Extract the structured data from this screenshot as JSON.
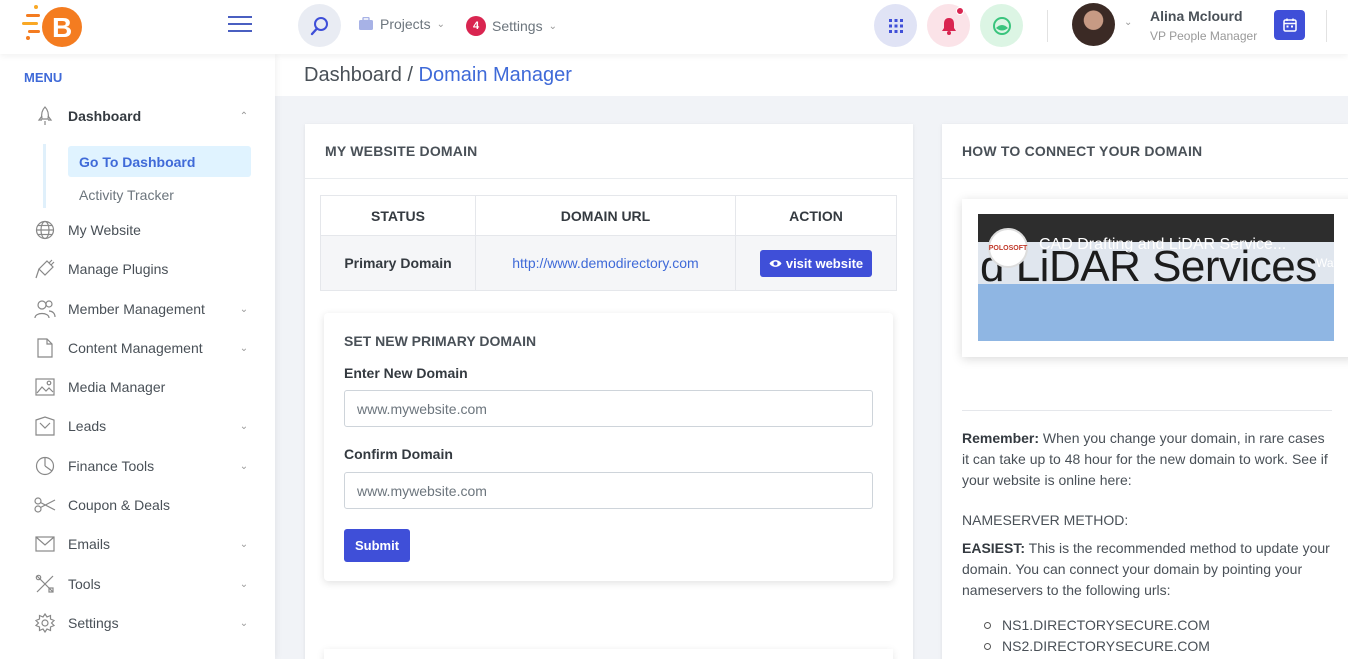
{
  "header": {
    "projects_label": "Projects",
    "settings_label": "Settings",
    "settings_badge": "4",
    "user_name": "Alina Mclourd",
    "user_role": "VP People Manager"
  },
  "sidebar": {
    "menu_title": "MENU",
    "items": [
      {
        "label": "Dashboard"
      },
      {
        "label": "My Website"
      },
      {
        "label": "Manage Plugins"
      },
      {
        "label": "Member Management"
      },
      {
        "label": "Content Management"
      },
      {
        "label": "Media Manager"
      },
      {
        "label": "Leads"
      },
      {
        "label": "Finance Tools"
      },
      {
        "label": "Coupon & Deals"
      },
      {
        "label": "Emails"
      },
      {
        "label": "Tools"
      },
      {
        "label": "Settings"
      }
    ],
    "sub_items": [
      {
        "label": "Go To Dashboard"
      },
      {
        "label": "Activity Tracker"
      }
    ]
  },
  "breadcrumb": {
    "root": "Dashboard",
    "separator": "/",
    "current": "Domain Manager"
  },
  "domain_card": {
    "title": "MY WEBSITE DOMAIN",
    "columns": [
      "STATUS",
      "DOMAIN URL",
      "ACTION"
    ],
    "row": {
      "status": "Primary Domain",
      "url": "http://www.demodirectory.com",
      "action": "visit website"
    }
  },
  "set_domain": {
    "title": "SET NEW PRIMARY DOMAIN",
    "new_label": "Enter New Domain",
    "new_placeholder": "www.mywebsite.com",
    "confirm_label": "Confirm Domain",
    "confirm_placeholder": "www.mywebsite.com",
    "submit_label": "Submit"
  },
  "connect_card": {
    "title": "HOW TO CONNECT YOUR DOMAIN",
    "video": {
      "title": "CAD Drafting and LiDAR Service...",
      "big_text": "d LiDAR Services",
      "side_text": "Wat",
      "logo_text": "POLOSOFT"
    },
    "remember_label": "Remember:",
    "remember_text": "When you change your domain, in rare cases it can take up to 48 hour for the new domain to work. See if your website is online here:",
    "method_heading": "NAMESERVER METHOD:",
    "easiest_label": "EASIEST:",
    "easiest_text": "This is the recommended method to update your domain. You can connect your domain by pointing your nameservers to the following urls:",
    "nameservers": [
      "NS1.DIRECTORYSECURE.COM",
      "NS2.DIRECTORYSECURE.COM"
    ]
  }
}
